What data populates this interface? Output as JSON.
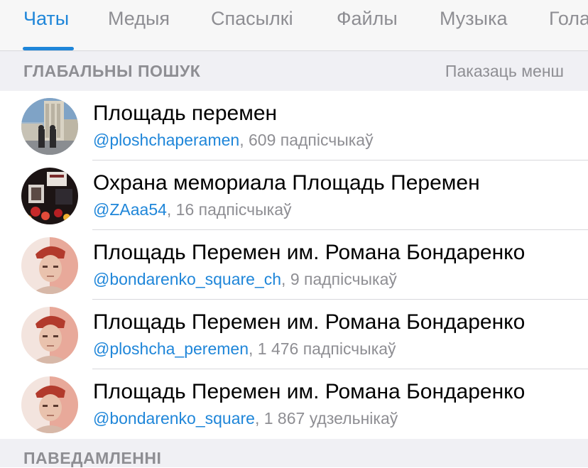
{
  "tabs": [
    {
      "label": "Чаты",
      "active": true
    },
    {
      "label": "Медыя",
      "active": false
    },
    {
      "label": "Спасылкі",
      "active": false
    },
    {
      "label": "Файлы",
      "active": false
    },
    {
      "label": "Музыка",
      "active": false
    },
    {
      "label": "Гола",
      "active": false
    }
  ],
  "global_search": {
    "title": "ГЛАБАЛЬНЫ ПОШУК",
    "action": "Паказаць менш"
  },
  "results": [
    {
      "title": "Площадь перемен",
      "handle": "@ploshchaperamen",
      "count": ", 609 падпісчыкаў",
      "avatar": "building-photo-avatar"
    },
    {
      "title": "Охрана мемориала Площадь Перемен",
      "handle": "@ZAaa54",
      "count": ", 16 падпісчыкаў",
      "avatar": "memorial-photo-avatar"
    },
    {
      "title": "Площадь Перемен им. Романа Бондаренко",
      "handle": "@bondarenko_square_ch",
      "count": ", 9 падпісчыкаў",
      "avatar": "portrait-avatar"
    },
    {
      "title": "Площадь Перемен им. Романа Бондаренко",
      "handle": "@ploshcha_peremen",
      "count": ", 1 476 падпісчыкаў",
      "avatar": "portrait-avatar"
    },
    {
      "title": "Площадь Перемен им. Романа Бондаренко",
      "handle": "@bondarenko_square",
      "count": ", 1 867 удзельнікаў",
      "avatar": "portrait-avatar"
    }
  ],
  "messages_section": {
    "title": "ПАВЕДАМЛЕННІ"
  },
  "colors": {
    "accent": "#1f86d9",
    "secondary_text": "#8e8e93",
    "section_bg": "#f0f0f4"
  }
}
